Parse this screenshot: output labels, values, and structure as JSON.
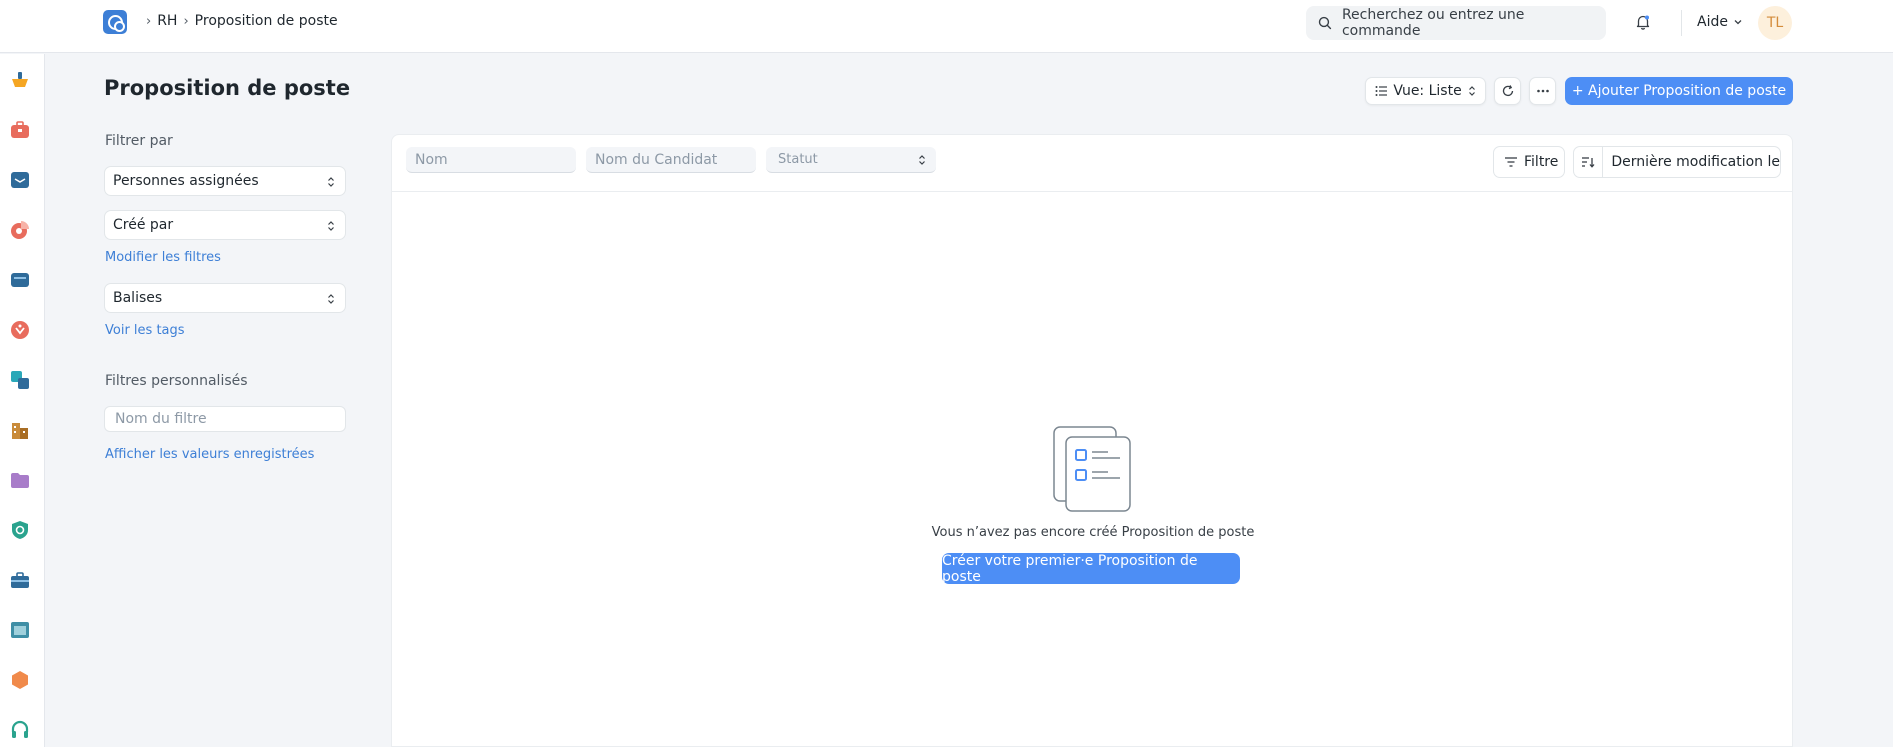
{
  "navbar": {
    "breadcrumbs": [
      {
        "label": "RH"
      },
      {
        "label": "Proposition de poste"
      }
    ],
    "search_placeholder": "Recherchez ou entrez une commande",
    "help_label": "Aide",
    "avatar_initials": "TL"
  },
  "rail": {
    "items": [
      {
        "icon": "home-icon",
        "color": "#f5a623"
      },
      {
        "icon": "briefcase-icon",
        "color": "#e86c5d"
      },
      {
        "icon": "inbox-icon",
        "color": "#2f6b9a"
      },
      {
        "icon": "pie-chart-icon",
        "color": "#e86c5d"
      },
      {
        "icon": "monitor-icon",
        "color": "#2f6b9a"
      },
      {
        "icon": "support-icon",
        "color": "#e86c5d"
      },
      {
        "icon": "layers-icon",
        "color": "#2aa8b8"
      },
      {
        "icon": "buildings-icon",
        "color": "#c98b3a"
      },
      {
        "icon": "folder-icon",
        "color": "#a87cc9"
      },
      {
        "icon": "shield-icon",
        "color": "#2aa38e"
      },
      {
        "icon": "toolbox-icon",
        "color": "#2f6b9a"
      },
      {
        "icon": "window-icon",
        "color": "#3f8fa6"
      },
      {
        "icon": "hexagon-icon",
        "color": "#f08a4b"
      },
      {
        "icon": "headset-icon",
        "color": "#2aa38e"
      }
    ]
  },
  "page": {
    "title": "Proposition de poste",
    "view_label": "Vue: Liste",
    "add_label": "+ Ajouter Proposition de poste"
  },
  "sidebar": {
    "filter_by_label": "Filtrer par",
    "assigned_label": "Personnes assignées",
    "created_by_label": "Créé par",
    "edit_filters_label": "Modifier les filtres",
    "tags_label": "Balises",
    "show_tags_label": "Voir les tags",
    "custom_filters_label": "Filtres personnalisés",
    "filter_name_placeholder": "Nom du filtre",
    "show_saved_label": "Afficher les valeurs enregistrées"
  },
  "list": {
    "name_placeholder": "Nom",
    "candidate_placeholder": "Nom du Candidat",
    "status_placeholder": "Statut",
    "filter_label": "Filtre",
    "sort_label": "Dernière modification le"
  },
  "empty_state": {
    "message": "Vous n’avez pas encore créé Proposition de poste",
    "create_label": "Créer votre premier·e Proposition de poste"
  },
  "colors": {
    "primary": "#4d8ef5",
    "link": "#3d7fd6",
    "background": "#f3f5f8"
  }
}
